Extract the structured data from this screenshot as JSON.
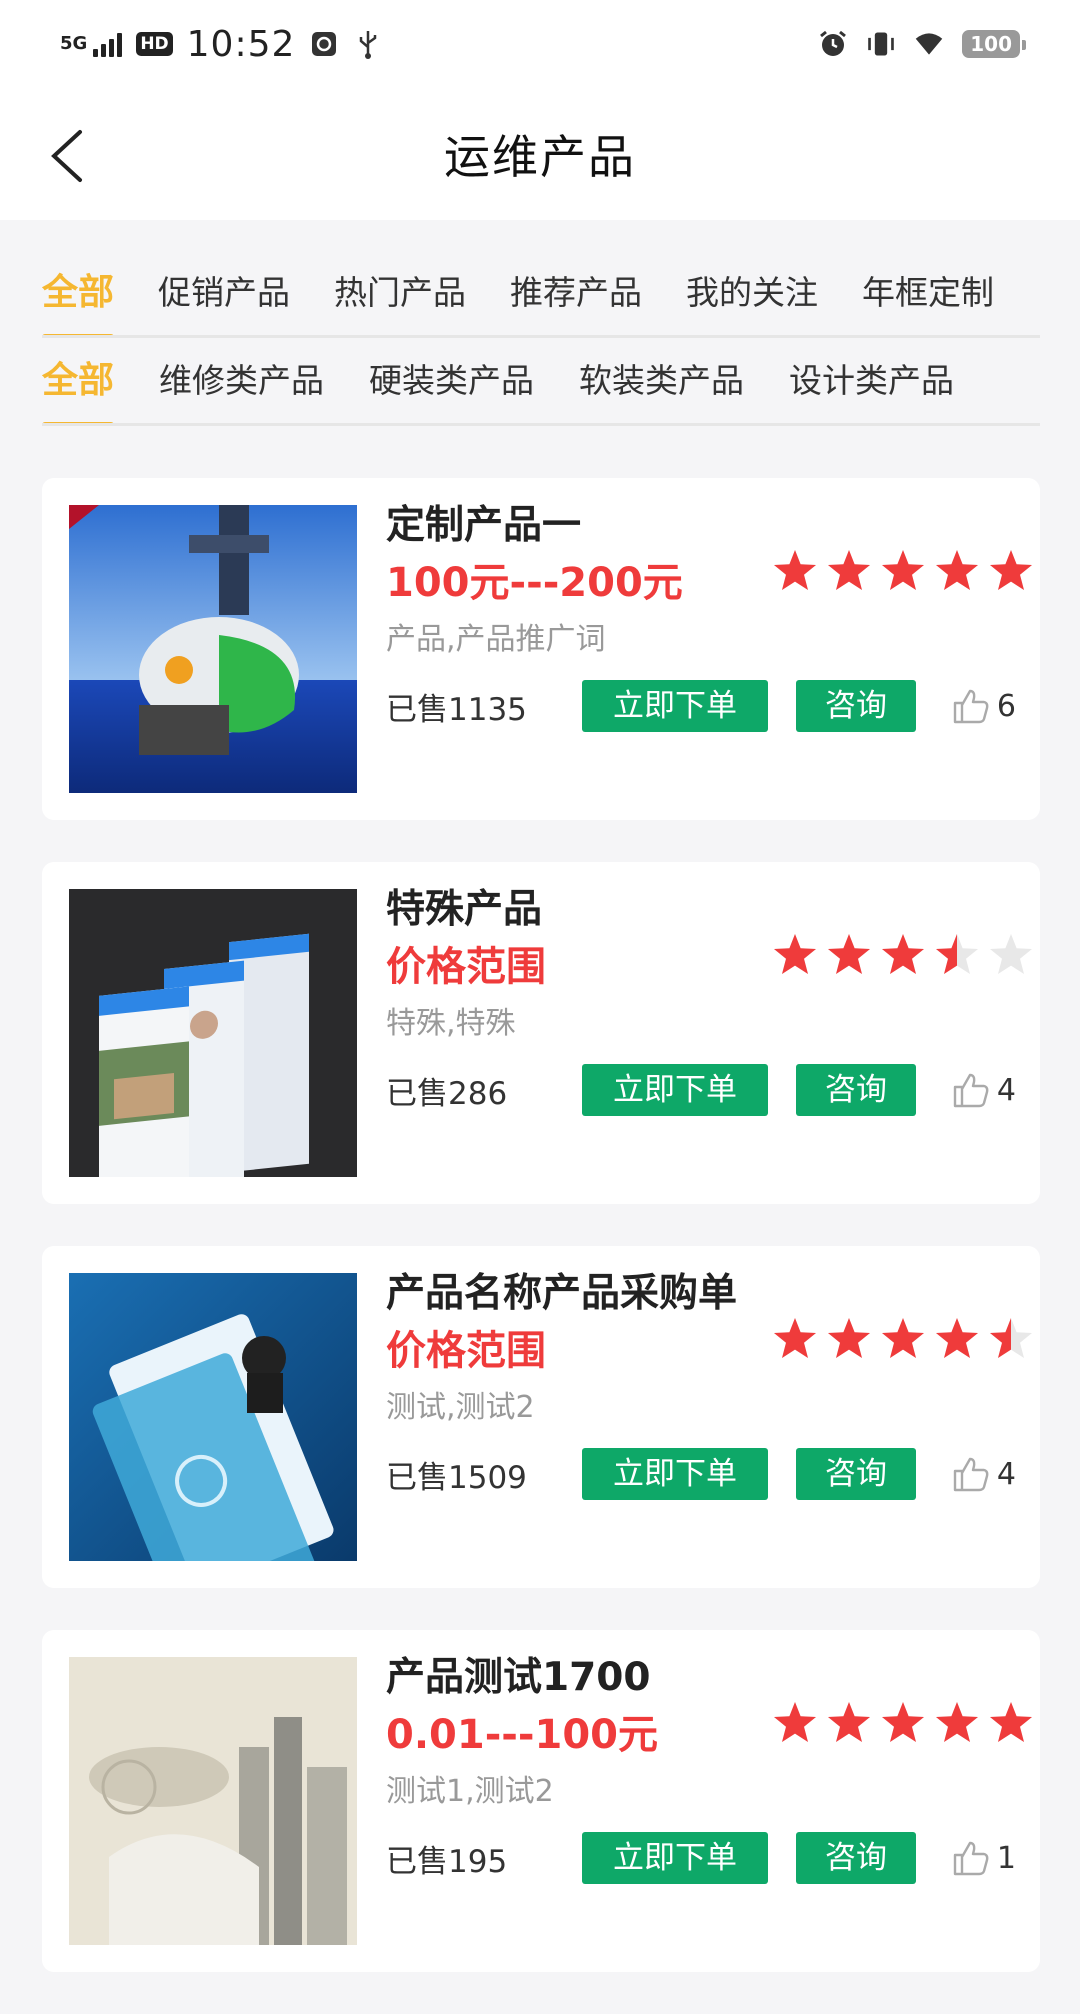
{
  "status_bar": {
    "network": "5G",
    "hd": "HD",
    "time": "10:52",
    "battery": "100"
  },
  "header": {
    "title": "运维产品"
  },
  "tabs_primary": [
    {
      "label": "全部",
      "active": true
    },
    {
      "label": "促销产品",
      "active": false
    },
    {
      "label": "热门产品",
      "active": false
    },
    {
      "label": "推荐产品",
      "active": false
    },
    {
      "label": "我的关注",
      "active": false
    },
    {
      "label": "年框定制",
      "active": false
    }
  ],
  "tabs_secondary": [
    {
      "label": "全部",
      "active": true
    },
    {
      "label": "维修类产品",
      "active": false
    },
    {
      "label": "硬装类产品",
      "active": false
    },
    {
      "label": "软装类产品",
      "active": false
    },
    {
      "label": "设计类产品",
      "active": false
    }
  ],
  "actions": {
    "order_label": "立即下单",
    "consult_label": "咨询"
  },
  "products": [
    {
      "name": "定制产品一",
      "price": "100元---200元",
      "tags": "产品,产品推广词",
      "sold": "已售1135",
      "likes": "6",
      "rating": 5
    },
    {
      "name": "特殊产品",
      "price": "价格范围",
      "tags": "特殊,特殊",
      "sold": "已售286",
      "likes": "4",
      "rating": 3.5
    },
    {
      "name": "产品名称产品采购单",
      "price": "价格范围",
      "tags": "测试,测试2",
      "sold": "已售1509",
      "likes": "4",
      "rating": 4.5
    },
    {
      "name": "产品测试1700",
      "price": "0.01---100元",
      "tags": "测试1,测试2",
      "sold": "已售195",
      "likes": "1",
      "rating": 5
    }
  ],
  "colors": {
    "accent": "#f5b731",
    "price": "#ef3b3b",
    "button": "#0ea868",
    "star": "#ef3b3b",
    "star_empty": "#e8e8e8"
  }
}
